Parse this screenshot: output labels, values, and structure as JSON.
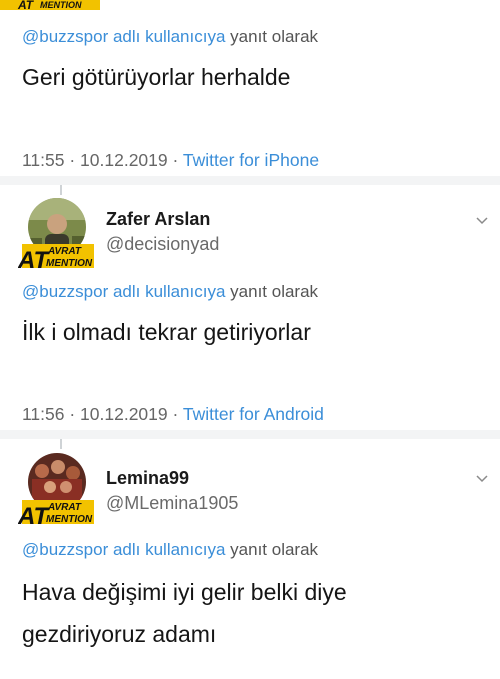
{
  "watermark": {
    "big": "AT",
    "small_top": "AVRAT",
    "small_bottom": "MENTION"
  },
  "tweets": [
    {
      "reply_to": "@buzzspor adlı kullanıcıya",
      "reply_suffix": "yanıt olarak",
      "text": "Geri götürüyorlar herhalde",
      "time": "11:55 · 10.12.2019 ·",
      "source": "Twitter for iPhone"
    },
    {
      "name": "Zafer Arslan",
      "handle": "@decisionyad",
      "reply_to": "@buzzspor adlı kullanıcıya",
      "reply_suffix": "yanıt olarak",
      "text": "İlk i olmadı tekrar getiriyorlar",
      "time": "11:56 · 10.12.2019 ·",
      "source": "Twitter for Android"
    },
    {
      "name": "Lemina99",
      "handle": "@MLemina1905",
      "reply_to": "@buzzspor adlı kullanıcıya",
      "reply_suffix": "yanıt olarak",
      "text_line1": "Hava değişimi iyi gelir belki diye",
      "text_line2": "gezdiriyoruz adamı"
    }
  ]
}
